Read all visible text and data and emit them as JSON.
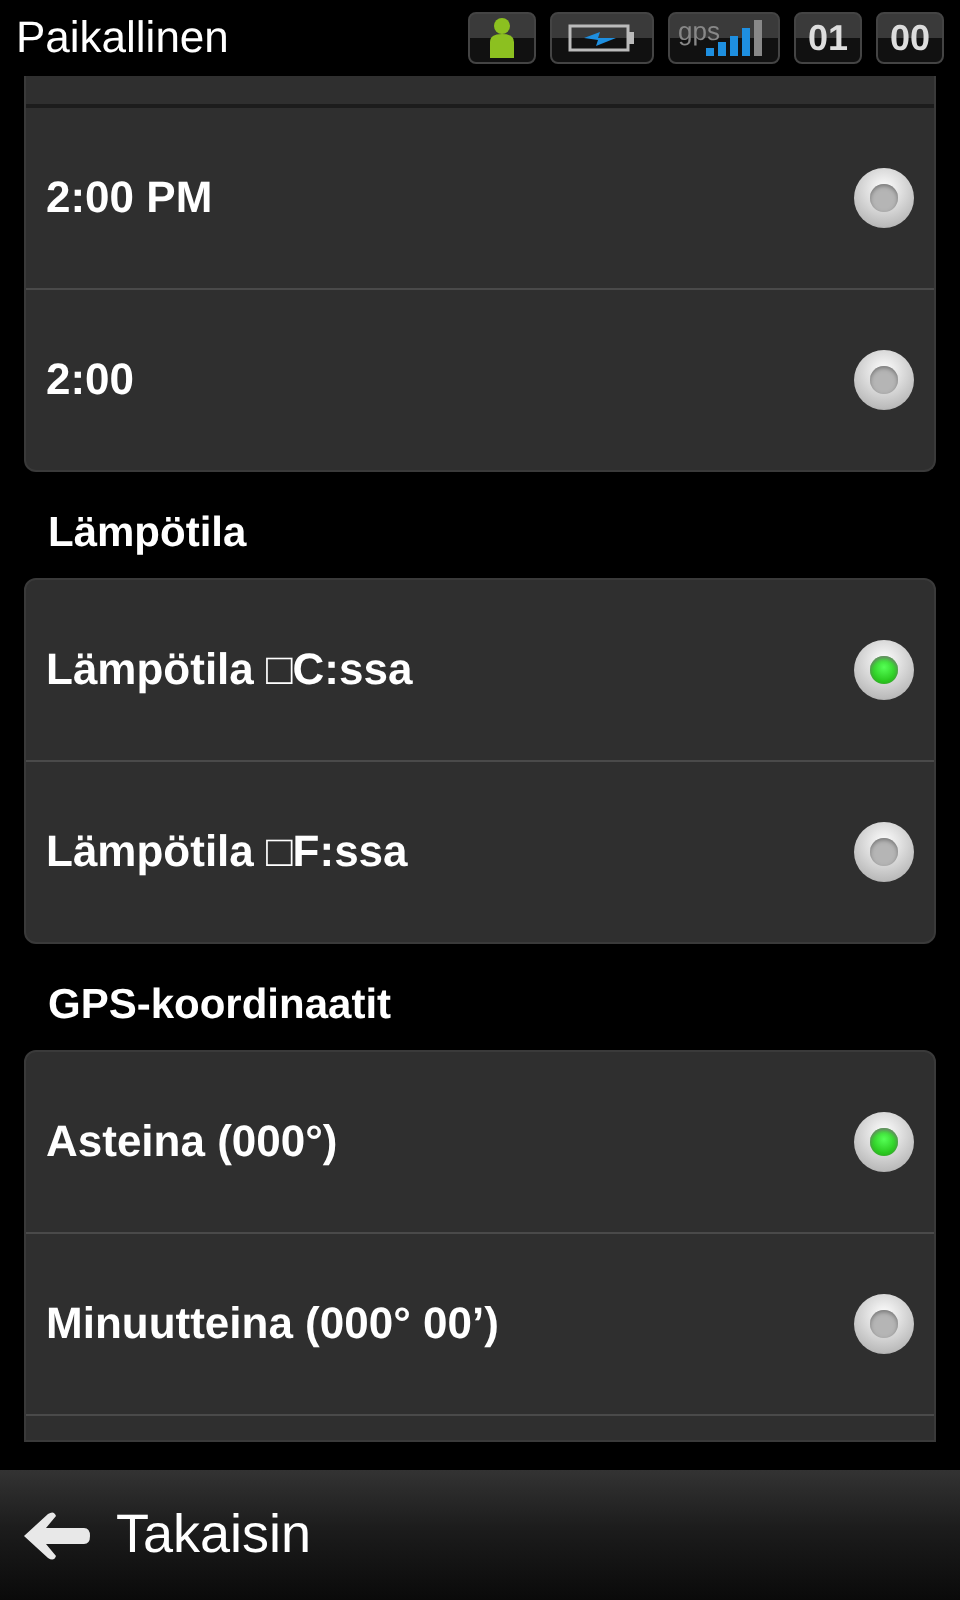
{
  "status_bar": {
    "title": "Paikallinen",
    "gps_label": "gps",
    "clock": [
      "01",
      "00"
    ]
  },
  "groups": [
    {
      "rows": [
        {
          "label": "2:00 PM",
          "selected": false
        },
        {
          "label": "2:00",
          "selected": false
        }
      ]
    },
    {
      "header": "Lämpötila",
      "rows": [
        {
          "label": "Lämpötila □C:ssa",
          "selected": true
        },
        {
          "label": "Lämpötila □F:ssa",
          "selected": false
        }
      ]
    },
    {
      "header": "GPS-koordinaatit",
      "rows": [
        {
          "label": "Asteina (000°)",
          "selected": true
        },
        {
          "label": "Minuutteina (000° 00’)",
          "selected": false
        }
      ]
    }
  ],
  "bottom_bar": {
    "back_label": "Takaisin"
  }
}
